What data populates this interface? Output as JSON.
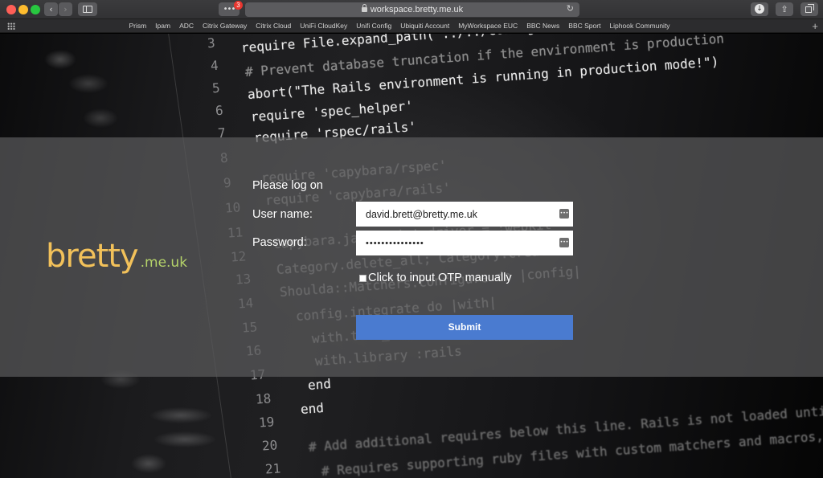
{
  "browser": {
    "url": "workspace.bretty.me.uk",
    "extension_badge": "3",
    "favorites": [
      "Prism",
      "Ipam",
      "ADC",
      "Citrix Gateway",
      "Citrix Cloud",
      "UniFi CloudKey",
      "Unifi Config",
      "Ubiquiti Account",
      "MyWorkspace EUC",
      "BBC News",
      "BBC Sport",
      "Liphook Community"
    ]
  },
  "background_code": {
    "line_numbers": [
      "3",
      "4",
      "5",
      "6",
      "7",
      "8",
      "9",
      "10",
      "11",
      "12",
      "13",
      "14",
      "15",
      "16",
      "17",
      "18",
      "19",
      "20",
      "21"
    ],
    "lines": [
      "require File.expand_path(\"../../config/environment\",",
      "# Prevent database truncation if the environment is production",
      "abort(\"The Rails environment is running in production mode!\")",
      "require 'spec_helper'",
      "require 'rspec/rails'",
      "require 'capybara/rspec'",
      "require 'capybara/rails'",
      "Capybara.javascript_driver = :webkit",
      "Category.delete_all; Category.create",
      "Shoulda::Matchers.configure do |config|",
      "config.integrate do |with|",
      "with.test_framework :rspec",
      "with.library :rails",
      "end",
      "end",
      "# Add additional requires below this line. Rails is not loaded until this point!",
      "# Requires supporting ruby files with custom matchers and macros, etc"
    ]
  },
  "logo": {
    "main": "bretty",
    "tld": ".me.uk"
  },
  "login": {
    "heading": "Please log on",
    "username_label": "User name:",
    "username_value": "david.brett@bretty.me.uk",
    "password_label": "Password:",
    "password_value": "•••••••••••••••",
    "otp_label": "Click to input OTP manually",
    "submit_label": "Submit"
  },
  "colors": {
    "accent": "#4a7bd0",
    "logo_main": "#f2c15a",
    "logo_tld": "#b5d36a"
  }
}
